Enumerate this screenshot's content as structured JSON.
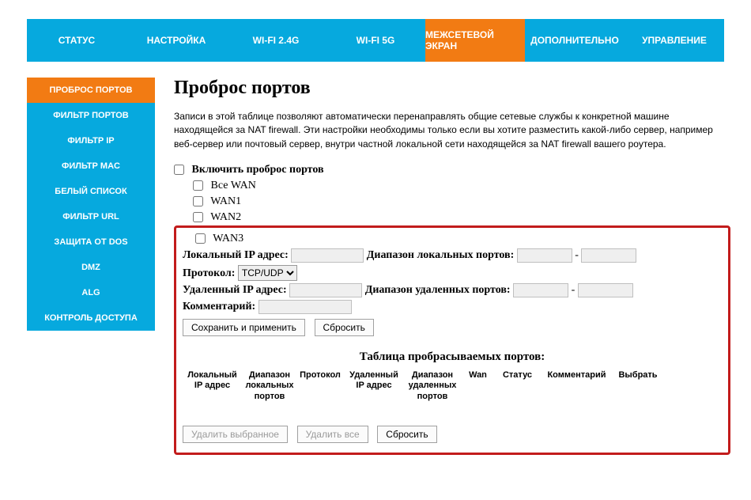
{
  "topnav": {
    "items": [
      "СТАТУС",
      "НАСТРОЙКА",
      "WI-FI 2.4G",
      "WI-FI 5G",
      "МЕЖСЕТЕВОЙ ЭКРАН",
      "ДОПОЛНИТЕЛЬНО",
      "УПРАВЛЕНИЕ"
    ],
    "active_index": 4
  },
  "sidebar": {
    "items": [
      "ПРОБРОС ПОРТОВ",
      "ФИЛЬТР ПОРТОВ",
      "ФИЛЬТР IP",
      "ФИЛЬТР MAC",
      "БЕЛЫЙ СПИСОК",
      "ФИЛЬТР URL",
      "ЗАЩИТА ОТ DOS",
      "DMZ",
      "ALG",
      "КОНТРОЛЬ ДОСТУПА"
    ],
    "active_index": 0
  },
  "page": {
    "title": "Проброс портов",
    "description": "Записи в этой таблице позволяют автоматически перенаправлять общие сетевые службы  к конкретной машине находящейся за NAT firewall. Эти настройки необходимы только  если вы хотите разместить какой-либо сервер, например веб-сервер или почтовый сервер, внутри частной локальной сети находящейся за NAT firewall вашего роутера."
  },
  "enable": {
    "label": "Включить проброс портов",
    "wan_all": "Все WAN",
    "wan1": "WAN1",
    "wan2": "WAN2",
    "wan3": "WAN3"
  },
  "form": {
    "local_ip_label": "Локальный IP адрес:",
    "local_port_label": "Диапазон локальных портов:",
    "protocol_label": "Протокол:",
    "protocol_value": "TCP/UDP",
    "remote_ip_label": "Удаленный IP адрес:",
    "remote_port_label": "Диапазон удаленных портов:",
    "comment_label": "Комментарий:",
    "save_btn": "Сохранить и применить",
    "reset_btn": "Сбросить"
  },
  "table": {
    "title": "Таблица пробрасываемых портов:",
    "headers": {
      "local_ip": "Локальный IP адрес",
      "local_port": "Диапазон локальных портов",
      "protocol": "Протокол",
      "remote_ip": "Удаленный IP адрес",
      "remote_port": "Диапазон удаленных портов",
      "wan": "Wan",
      "status": "Статус",
      "comment": "Комментарий",
      "select": "Выбрать"
    },
    "delete_sel": "Удалить выбранное",
    "delete_all": "Удалить все",
    "reset": "Сбросить"
  }
}
